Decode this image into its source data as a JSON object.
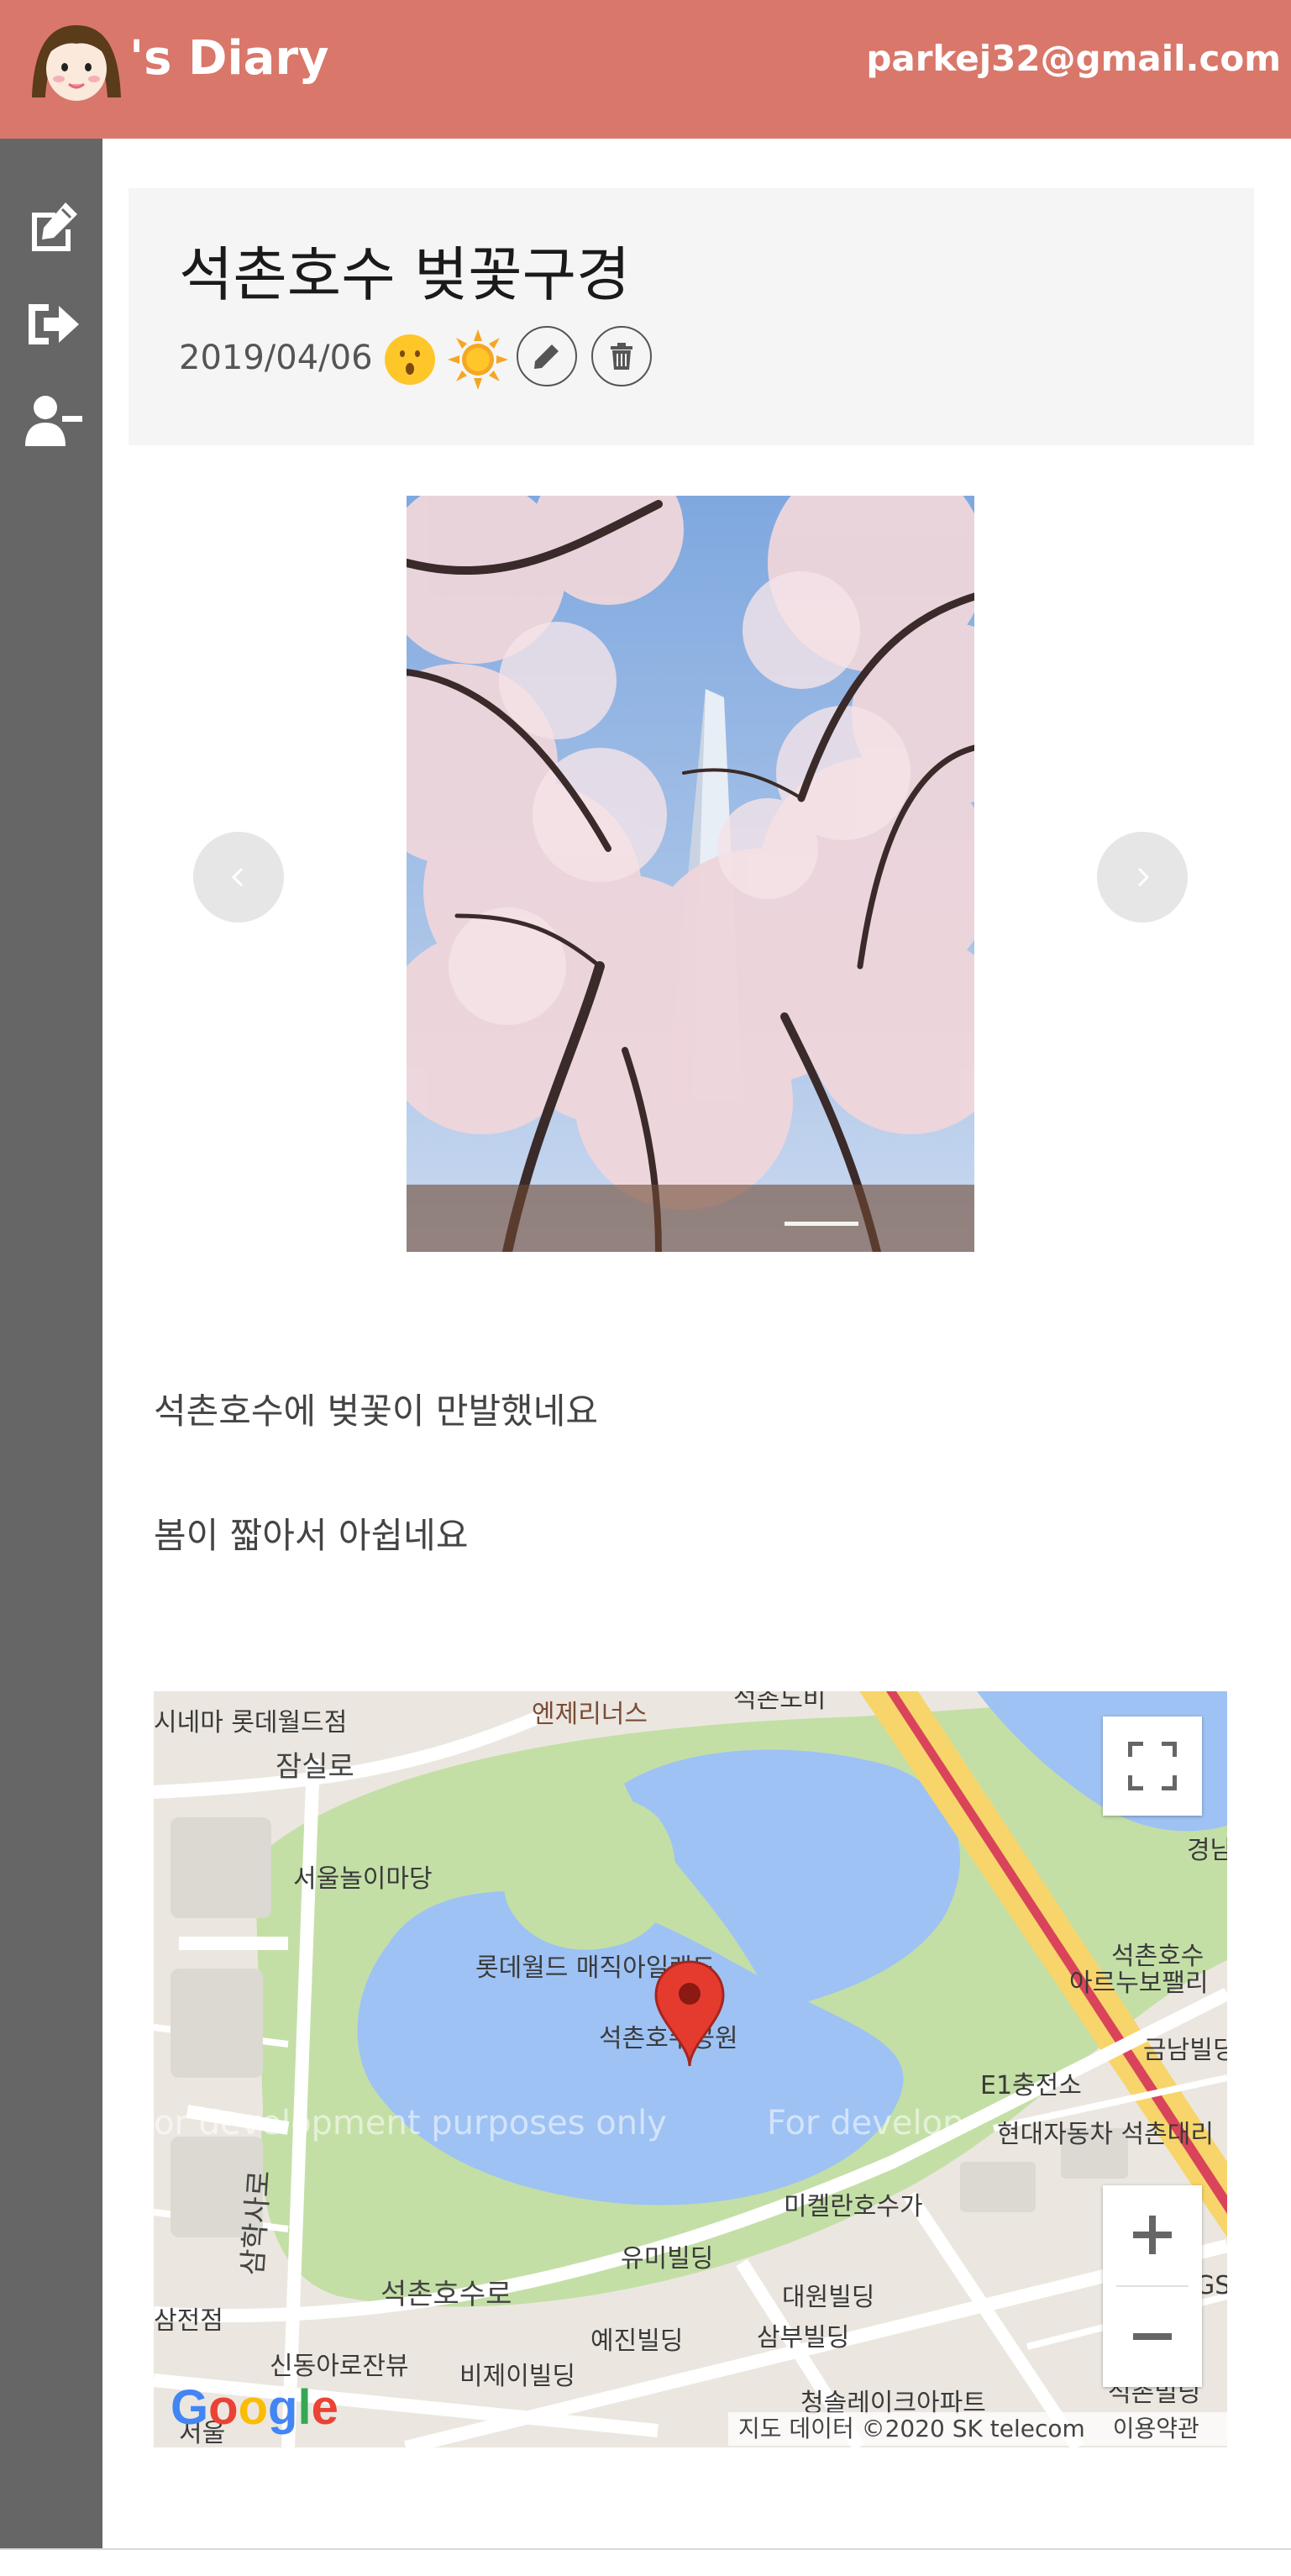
{
  "header": {
    "app_title": "'s Diary",
    "user_email": "parkej32@gmail.com",
    "brand_color": "#d9776b"
  },
  "sidebar": {
    "items": [
      {
        "icon": "write-diary-icon"
      },
      {
        "icon": "logout-icon"
      },
      {
        "icon": "remove-user-icon"
      }
    ],
    "color": "#666666"
  },
  "post": {
    "title": "석촌호수 벚꽃구경",
    "date": "2019/04/06",
    "mood_icon": "surprised-face-icon",
    "weather_icon": "sun-icon",
    "actions": {
      "edit_icon": "pencil-icon",
      "delete_icon": "trash-icon"
    },
    "body_lines": [
      "석촌호수에 벚꽃이 만발했네요",
      "봄이 짧아서 아쉽네요"
    ]
  },
  "carousel": {
    "image_description": "cherry blossoms",
    "slide_count": 1,
    "active_slide": 1
  },
  "map": {
    "labels": {
      "cinema": "시네마 롯데월드점",
      "engene": "엔제리너스",
      "seokchon_nobi": "석촌노비",
      "jamsil_ro": "잠실로",
      "play_ground": "서울놀이마당",
      "magic_island": "롯데월드 매직아일랜드",
      "park": "석촌호수공원",
      "gyeongin": "경남",
      "seokchon_lake": "석촌호수",
      "areunubo": "아르누보팰리",
      "geumnam": "금남빌딩",
      "e1": "E1충전소",
      "hyundai": "현대자동차 석촌대리",
      "michelan": "미켈란호수가",
      "yumi": "유미빌딩",
      "samhak": "삼학사로",
      "seokchon_ro": "석촌호수로",
      "daewon": "대원빌딩",
      "gs": "GS",
      "samjeon": "삼전점",
      "yejin": "예진빌딩",
      "sambu": "삼부빌딩",
      "sindong": "신동아로잔뷰",
      "bje": "비제이빌딩",
      "cheongsol": "청솔레이크아파트",
      "seokchon_bldg": "석촌빌딩",
      "seoul": "서울"
    },
    "watermark_left": "or development purposes only",
    "watermark_right": "For develop",
    "google_logo": "Google",
    "footer_data": "지도 데이터 ©2020 SK telecom",
    "footer_terms": "이용약관",
    "zoom_in": "+",
    "zoom_out": "−"
  }
}
